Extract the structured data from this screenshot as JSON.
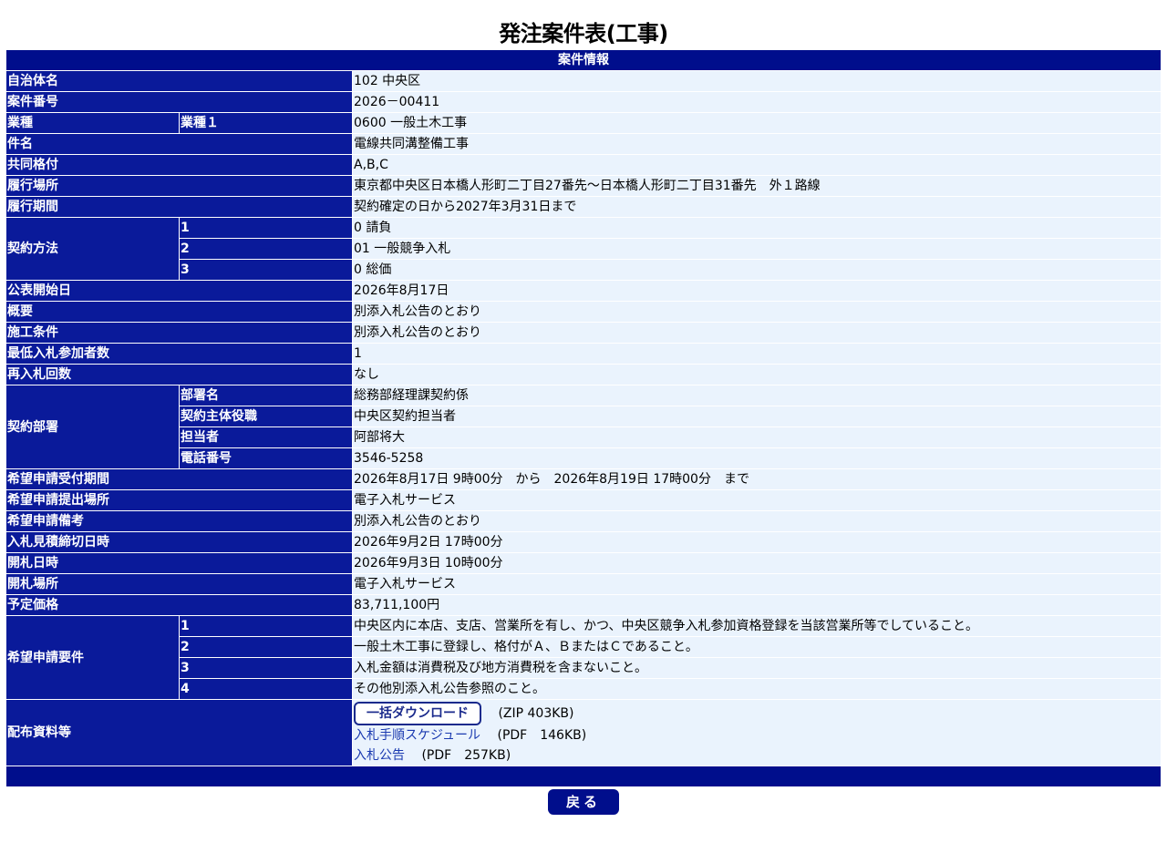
{
  "title": "発注案件表(工事)",
  "section_header": "案件情報",
  "fields": {
    "municipality": {
      "label": "自治体名",
      "value": "102 中央区"
    },
    "case_number": {
      "label": "案件番号",
      "value": "2026－00411"
    },
    "industry": {
      "label": "業種",
      "sub_label": "業種１",
      "value": "0600 一般土木工事"
    },
    "subject": {
      "label": "件名",
      "value": "電線共同溝整備工事"
    },
    "joint_rank": {
      "label": "共同格付",
      "value": "A,B,C"
    },
    "location": {
      "label": "履行場所",
      "value": "東京都中央区日本橋人形町二丁目27番先～日本橋人形町二丁目31番先　外１路線"
    },
    "period": {
      "label": "履行期間",
      "value": "契約確定の日から2027年3月31日まで"
    },
    "contract_method": {
      "label": "契約方法",
      "rows": [
        {
          "num": "1",
          "value": "0 請負"
        },
        {
          "num": "2",
          "value": "01 一般競争入札"
        },
        {
          "num": "3",
          "value": "0 総価"
        }
      ]
    },
    "publish_date": {
      "label": "公表開始日",
      "value": "2026年8月17日"
    },
    "summary": {
      "label": "概要",
      "value": "別添入札公告のとおり"
    },
    "conditions": {
      "label": "施工条件",
      "value": "別添入札公告のとおり"
    },
    "min_bidders": {
      "label": "最低入札参加者数",
      "value": "1"
    },
    "rebid_count": {
      "label": "再入札回数",
      "value": "なし"
    },
    "department": {
      "label": "契約部署",
      "rows": [
        {
          "sub_label": "部署名",
          "value": "総務部経理課契約係"
        },
        {
          "sub_label": "契約主体役職",
          "value": "中央区契約担当者"
        },
        {
          "sub_label": "担当者",
          "value": "阿部将大"
        },
        {
          "sub_label": "電話番号",
          "value": "3546-5258"
        }
      ]
    },
    "application_period": {
      "label": "希望申請受付期間",
      "value": "2026年8月17日 9時00分　から　2026年8月19日 17時00分　まで"
    },
    "application_place": {
      "label": "希望申請提出場所",
      "value": "電子入札サービス"
    },
    "application_note": {
      "label": "希望申請備考",
      "value": "別添入札公告のとおり"
    },
    "bid_deadline": {
      "label": "入札見積締切日時",
      "value": "2026年9月2日 17時00分"
    },
    "opening_datetime": {
      "label": "開札日時",
      "value": "2026年9月3日 10時00分"
    },
    "opening_place": {
      "label": "開札場所",
      "value": "電子入札サービス"
    },
    "planned_price": {
      "label": "予定価格",
      "value": "83,711,100円"
    },
    "requirements": {
      "label": "希望申請要件",
      "rows": [
        {
          "num": "1",
          "value": "中央区内に本店、支店、営業所を有し、かつ、中央区競争入札参加資格登録を当該営業所等でしていること。"
        },
        {
          "num": "2",
          "value": "一般土木工事に登録し、格付がＡ、ＢまたはＣであること。"
        },
        {
          "num": "3",
          "value": "入札金額は消費税及び地方消費税を含まないこと。"
        },
        {
          "num": "4",
          "value": "その他別添入札公告参照のこと。"
        }
      ]
    },
    "documents": {
      "label": "配布資料等",
      "download_button": "一括ダウンロード",
      "download_note": "(ZIP 403KB)",
      "links": [
        {
          "text": "入札手順スケジュール",
          "note": "(PDF　146KB)"
        },
        {
          "text": "入札公告",
          "note": "(PDF　257KB)"
        }
      ]
    }
  },
  "back_button": "戻る",
  "colors": {
    "header_bg": "#000e8c",
    "label_bg": "#0a1a9a",
    "value_bg": "#eaf3fd",
    "link": "#1a3ab0"
  }
}
